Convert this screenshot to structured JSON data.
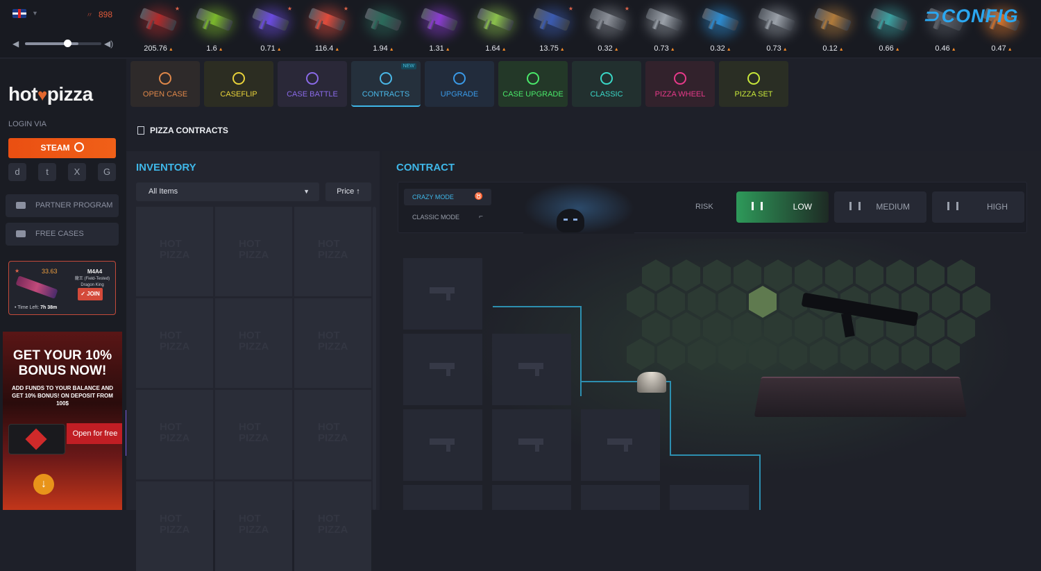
{
  "header": {
    "online_count": "898",
    "volume_level": 0.55,
    "brand_logo": "CONFIG",
    "recent_drops": [
      {
        "price": "205.76",
        "color": "#b02a2a",
        "star": true
      },
      {
        "price": "1.6",
        "color": "#7ab82a",
        "star": false
      },
      {
        "price": "0.71",
        "color": "#6a4ae0",
        "star": true
      },
      {
        "price": "116.4",
        "color": "#e04a3a",
        "star": true
      },
      {
        "price": "1.94",
        "color": "#2a6a5a",
        "star": false
      },
      {
        "price": "1.31",
        "color": "#8a3ad0",
        "star": false
      },
      {
        "price": "1.64",
        "color": "#8ac04a",
        "star": false
      },
      {
        "price": "13.75",
        "color": "#3a5ab0",
        "star": true
      },
      {
        "price": "0.32",
        "color": "#8a8e96",
        "star": true
      },
      {
        "price": "0.73",
        "color": "#9aa0a8",
        "star": false
      },
      {
        "price": "0.32",
        "color": "#2a8ad0",
        "star": false
      },
      {
        "price": "0.73",
        "color": "#9aa0a8",
        "star": false
      },
      {
        "price": "0.12",
        "color": "#b07a3a",
        "star": false
      },
      {
        "price": "0.66",
        "color": "#3aa0a0",
        "star": false
      },
      {
        "price": "0.46",
        "color": "#5a5e66",
        "star": false
      },
      {
        "price": "0.47",
        "color": "#d0702a",
        "star": false
      }
    ]
  },
  "sidebar": {
    "logo_text_left": "hot",
    "logo_text_right": "pizza",
    "login_via": "LOGIN VIA",
    "steam_label": "STEAM",
    "socials": [
      "discord-icon",
      "twitch-icon",
      "x-icon",
      "google-icon"
    ],
    "social_glyphs": [
      "d",
      "t",
      "X",
      "G"
    ],
    "partner_program": "PARTNER PROGRAM",
    "free_cases": "FREE CASES",
    "giveaway": {
      "price": "33.63",
      "weapon": "M4A4",
      "skin_line1": "龍王 (Field-Tested)",
      "skin_line2": "Dragon King",
      "join_label": "JOIN",
      "time_label": "Time Left:",
      "time_value": "7h 38m"
    },
    "promo": {
      "title": "GET YOUR 10% BONUS NOW!",
      "subtitle": "ADD FUNDS TO YOUR BALANCE AND GET 10% BONUS! ON DEPOSIT FROM 100$",
      "open_label": "Open for free"
    }
  },
  "nav": {
    "modes": [
      {
        "label": "OPEN CASE",
        "color": "#e0884a",
        "bg": "#2e2a2a",
        "active": false,
        "new": false
      },
      {
        "label": "CASEFLIP",
        "color": "#e8d23a",
        "bg": "#2c2d22",
        "active": false,
        "new": false
      },
      {
        "label": "CASE BATTLE",
        "color": "#8a6ae8",
        "bg": "#2a2838",
        "active": false,
        "new": false
      },
      {
        "label": "CONTRACTS",
        "color": "#4ab8e8",
        "bg": "#25303c",
        "active": true,
        "new": true
      },
      {
        "label": "UPGRADE",
        "color": "#3a9ae8",
        "bg": "#222c3c",
        "active": false,
        "new": false
      },
      {
        "label": "CASE UPGRADE",
        "color": "#4ae86a",
        "bg": "#233828",
        "active": false,
        "new": false
      },
      {
        "label": "CLASSIC",
        "color": "#3ad8c8",
        "bg": "#22302f",
        "active": false,
        "new": false
      },
      {
        "label": "PIZZA WHEEL",
        "color": "#e83a8a",
        "bg": "#32222c",
        "active": false,
        "new": false
      },
      {
        "label": "PIZZA SET",
        "color": "#c8e83a",
        "bg": "#2a2e24",
        "active": false,
        "new": false
      }
    ],
    "new_badge": "NEW"
  },
  "page": {
    "title": "PIZZA CONTRACTS"
  },
  "inventory": {
    "title": "INVENTORY",
    "filter_value": "All Items",
    "sort_label": "Price ↑",
    "watermark": "HOT PIZZA",
    "cell_count": 12
  },
  "contract": {
    "title": "CONTRACT",
    "crazy_mode": "CRAZY MODE",
    "classic_mode": "CLASSIC MODE",
    "risk_label": "RISK",
    "risk_options": [
      {
        "label": "LOW",
        "active": true
      },
      {
        "label": "MEDIUM",
        "active": false
      },
      {
        "label": "HIGH",
        "active": false
      }
    ]
  }
}
